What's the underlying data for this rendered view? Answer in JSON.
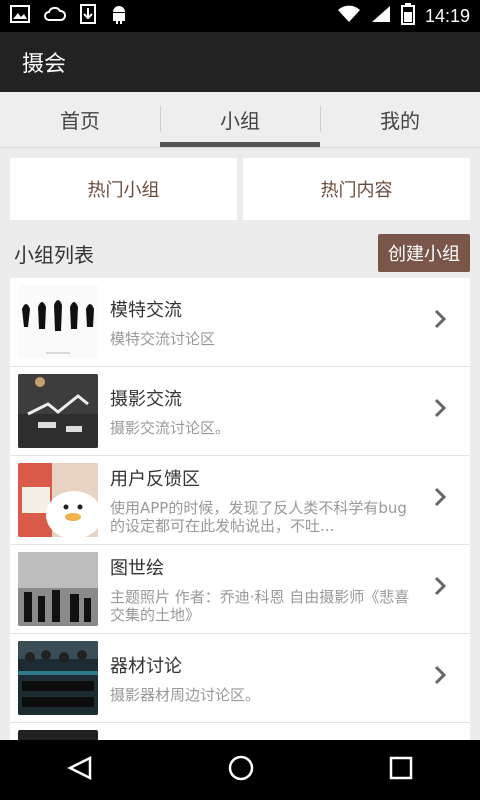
{
  "status_bar": {
    "time": "14:19",
    "icons_left": [
      "image-icon",
      "cloud-icon",
      "download-icon",
      "android-icon"
    ],
    "icons_right": [
      "wifi-icon",
      "signal-icon",
      "battery-icon"
    ]
  },
  "app": {
    "title": "摄会"
  },
  "tabs": [
    {
      "label": "首页",
      "active": false
    },
    {
      "label": "小组",
      "active": true
    },
    {
      "label": "我的",
      "active": false
    }
  ],
  "hot": {
    "groups_label": "热门小组",
    "content_label": "热门内容"
  },
  "list_header": {
    "title": "小组列表",
    "create_label": "创建小组"
  },
  "groups": [
    {
      "name": "模特交流",
      "desc": "模特交流讨论区"
    },
    {
      "name": "摄影交流",
      "desc": "摄影交流讨论区。"
    },
    {
      "name": "用户反馈区",
      "desc": "使用APP的时候，发现了反人类不科学有bug的设定都可在此发帖说出，不吐..."
    },
    {
      "name": "图世绘",
      "desc": "主题照片 作者：乔迪·科恩 自由摄影师《悲喜交集的土地》"
    },
    {
      "name": "器材讨论",
      "desc": "摄影器材周边讨论区。"
    }
  ],
  "colors": {
    "accent": "#7a564a",
    "tab_indicator": "#555555",
    "action_bar": "#222222"
  },
  "nav_bar": {
    "icons": [
      "back-icon",
      "home-icon",
      "recents-icon"
    ]
  }
}
